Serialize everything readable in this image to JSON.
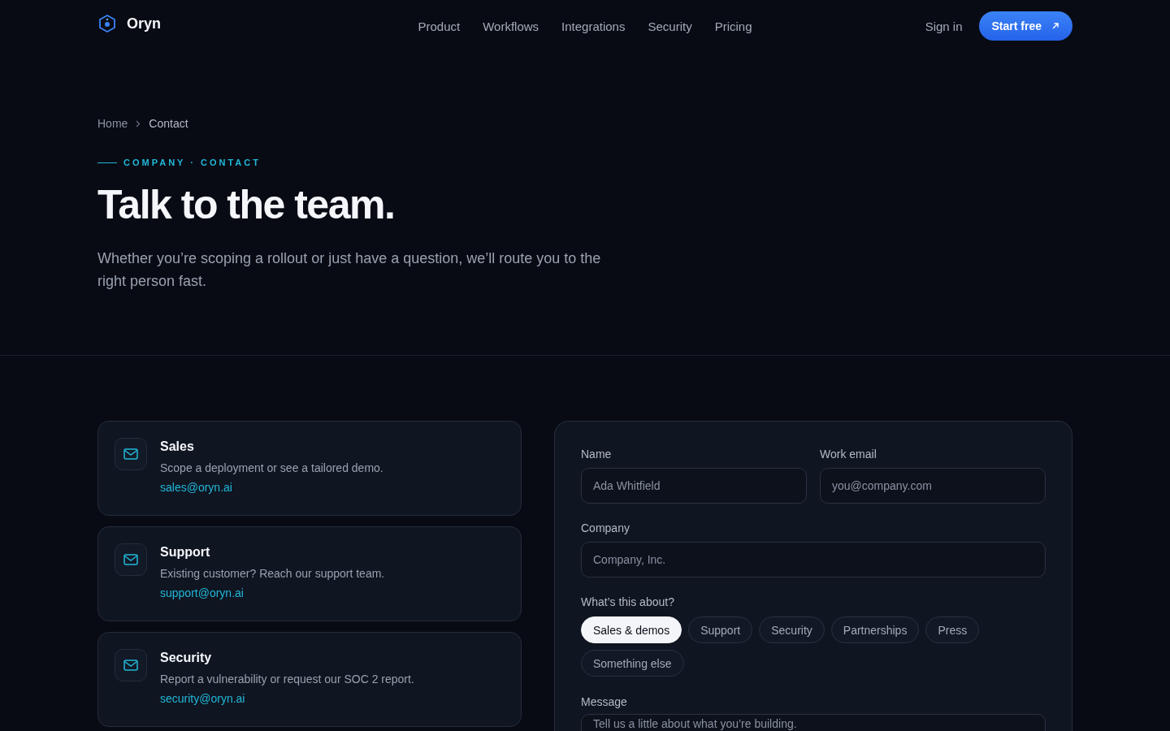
{
  "nav": {
    "brand": "Oryn",
    "links": [
      "Product",
      "Workflows",
      "Integrations",
      "Security",
      "Pricing"
    ],
    "sign_in": "Sign in",
    "cta": "Start free"
  },
  "breadcrumb": [
    "Home",
    "Contact"
  ],
  "eyebrow": "COMPANY · CONTACT",
  "title": "Talk to the team.",
  "lead": "Whether you’re scoping a rollout or just have a question, we’ll route you to the right person fast.",
  "contacts": [
    {
      "title": "Sales",
      "description": "Scope a deployment or see a tailored demo.",
      "email": "sales@oryn.ai"
    },
    {
      "title": "Support",
      "description": "Existing customer? Reach our support team.",
      "email": "support@oryn.ai"
    },
    {
      "title": "Security",
      "description": "Report a vulnerability or request our SOC 2 report.",
      "email": "security@oryn.ai"
    }
  ],
  "form": {
    "rows": [
      [
        {
          "label": "Name",
          "placeholder": "Ada Whitfield"
        },
        {
          "label": "Work email",
          "placeholder": "you@company.com"
        }
      ],
      [
        {
          "label": "Company",
          "placeholder": "Company, Inc."
        }
      ]
    ],
    "topic": {
      "label": "What’s this about?",
      "options": [
        {
          "label": "Sales & demos",
          "selected": true
        },
        {
          "label": "Support",
          "selected": false
        },
        {
          "label": "Security",
          "selected": false
        },
        {
          "label": "Partnerships",
          "selected": false
        },
        {
          "label": "Press",
          "selected": false
        },
        {
          "label": "Something else",
          "selected": false
        }
      ]
    },
    "message": {
      "label": "Message",
      "placeholder": "Tell us a little about what you’re building."
    }
  }
}
